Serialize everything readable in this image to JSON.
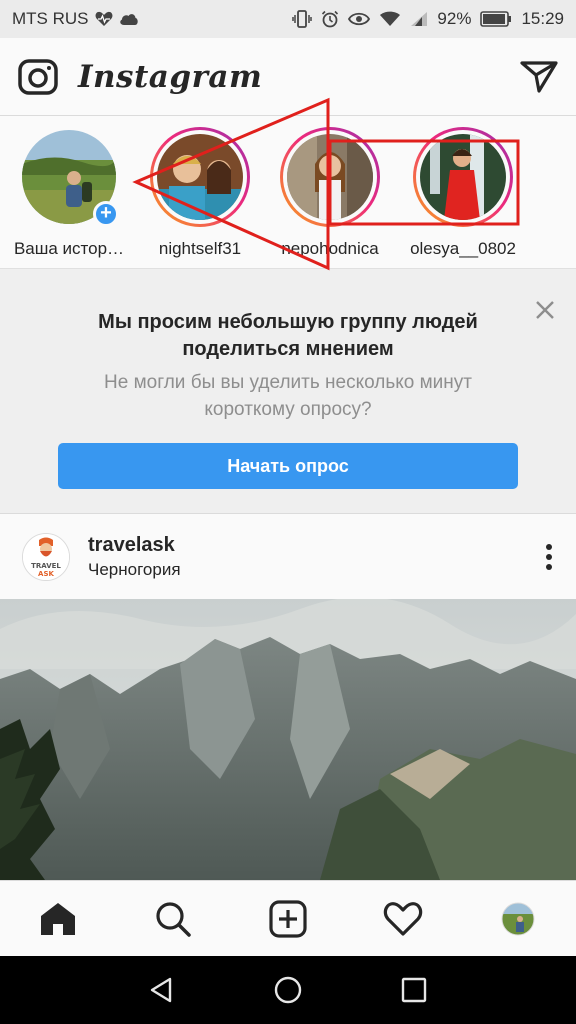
{
  "status_bar": {
    "carrier": "MTS RUS",
    "battery": "92%",
    "time": "15:29"
  },
  "app_bar": {
    "logo": "Instagram",
    "camera_icon": "camera-icon",
    "send_icon": "direct-send-icon"
  },
  "stories": [
    {
      "name": "Ваша истор…",
      "own": true
    },
    {
      "name": "nightself31",
      "own": false
    },
    {
      "name": "nepohodnica",
      "own": false
    },
    {
      "name": "olesya__0802",
      "own": false
    }
  ],
  "survey": {
    "title_line1": "Мы просим небольшую группу людей",
    "title_line2": "поделиться мнением",
    "text_line1": "Не могли бы вы уделить несколько минут",
    "text_line2": "короткому опросу?",
    "button": "Начать опрос"
  },
  "post": {
    "username": "travelask",
    "location": "Черногория",
    "avatar_text_line1": "TRAVEL",
    "avatar_text_line2": "ASK"
  },
  "tab_bar": [
    "home-icon",
    "search-icon",
    "new-post-icon",
    "activity-heart-icon",
    "profile-avatar"
  ],
  "colors": {
    "accent_blue": "#3897f0",
    "annotation_red": "#e0201c"
  }
}
